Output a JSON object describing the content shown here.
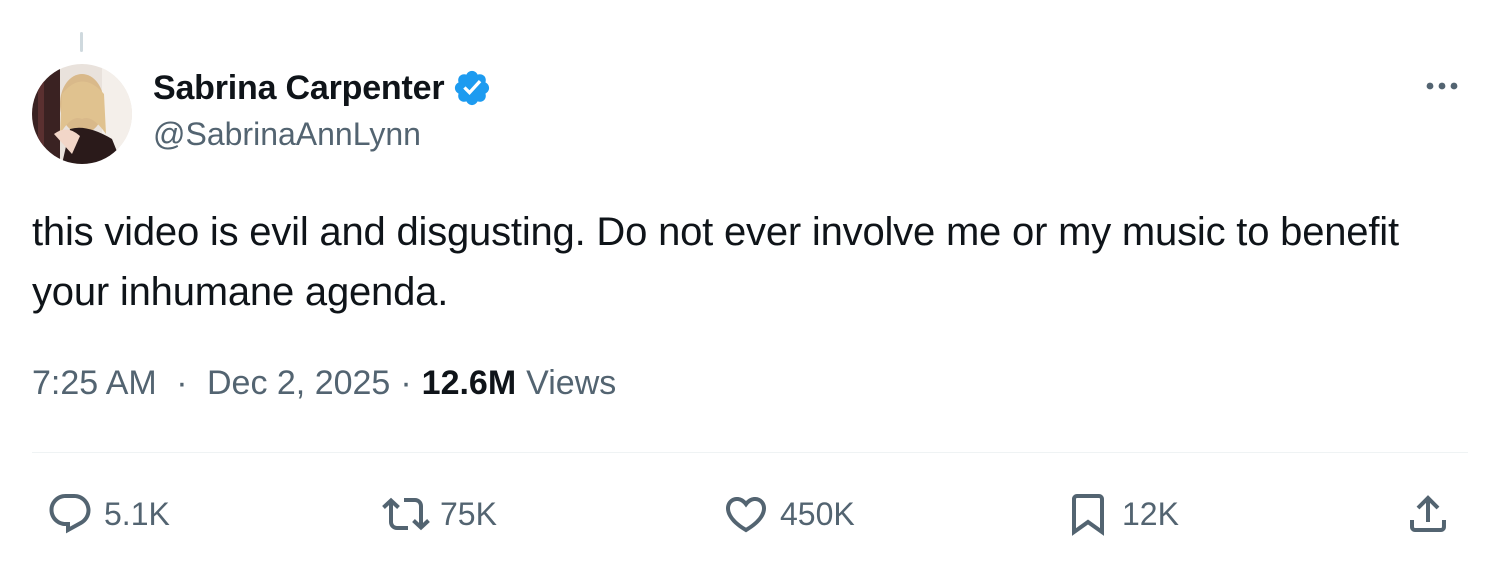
{
  "author": {
    "display_name": "Sabrina Carpenter",
    "handle": "@SabrinaAnnLynn",
    "verified": true,
    "verified_color": "#1d9bf0"
  },
  "tweet": {
    "text": "this video is evil and disgusting. Do not ever involve me or my music to benefit your inhumane agenda.",
    "time": "7:25 AM",
    "separator": "·",
    "date": "Dec 2, 2025",
    "views_count": "12.6M",
    "views_label": "Views"
  },
  "actions": {
    "reply": {
      "icon": "reply-icon",
      "count": "5.1K"
    },
    "repost": {
      "icon": "repost-icon",
      "count": "75K"
    },
    "like": {
      "icon": "heart-icon",
      "count": "450K"
    },
    "bookmark": {
      "icon": "bookmark-icon",
      "count": "12K"
    },
    "share": {
      "icon": "share-icon"
    }
  },
  "colors": {
    "text_primary": "#0f1419",
    "text_secondary": "#536471",
    "divider": "#eff3f4"
  }
}
